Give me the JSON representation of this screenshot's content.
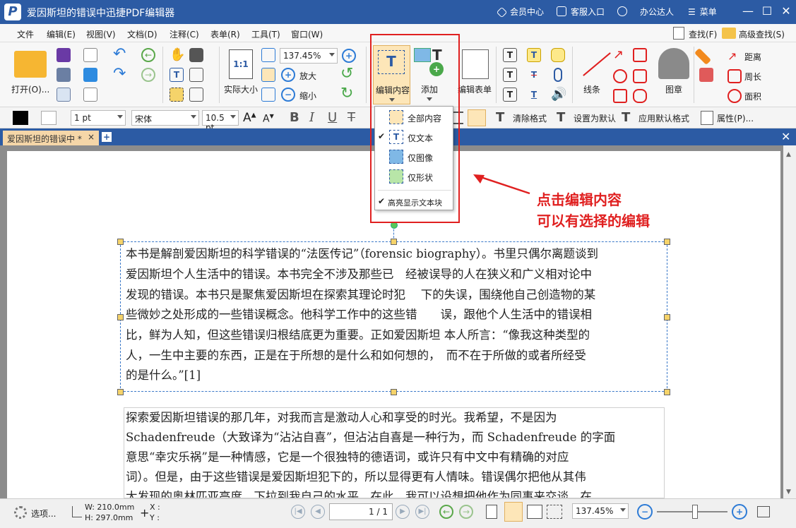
{
  "titlebar": {
    "title": "爱因斯坦的错误中迅捷PDF编辑器",
    "vip": "会员中心",
    "service": "客服入口",
    "user": "办公达人",
    "menu": "菜单",
    "logo": "P"
  },
  "menu": [
    "文件",
    "编辑(E)",
    "视图(V)",
    "文档(D)",
    "注释(C)",
    "表单(R)",
    "工具(T)",
    "窗口(W)"
  ],
  "menu_right": {
    "find": "查找(F)",
    "advanced_find": "高级查找(S)"
  },
  "ribbon": {
    "open": "打开(O)...",
    "actual_size": "实际大小",
    "zoom": "137.45%",
    "zoom_in": "放大",
    "zoom_out": "缩小",
    "edit_content": "编辑内容",
    "add": "添加",
    "edit_form": "编辑表单",
    "line": "线条",
    "stamp": "图章",
    "distance": "距离",
    "perimeter": "周长",
    "area": "面积",
    "actual_size_icon": "1:1"
  },
  "format": {
    "stroke": "1 pt",
    "font": "宋体",
    "size": "10.5 pt",
    "clear_format": "清除格式",
    "set_default": "设置为默认",
    "apply_default": "应用默认格式",
    "properties": "属性(P)..."
  },
  "tab": {
    "label": "爱因斯坦的错误中 *",
    "close": "×"
  },
  "dropdown": {
    "all": "全部内容",
    "text_only": "仅文本",
    "image_only": "仅图像",
    "shape_only": "仅形状",
    "highlight": "高亮显示文本块"
  },
  "annotation": {
    "line1": "点击编辑内容",
    "line2": "可以有选择的编辑"
  },
  "paragraph1": [
    "本书是解剖爱因斯坦的科学错误的“法医传记”（forensic biography）。书里只偶尔离题谈到",
    "爱因斯坦个人生活中的错误。本书完全不涉及那些已　经被误导的人在狭义和广义相对论中",
    "发现的错误。本书只是聚焦爱因斯坦在探索其理论时犯　 下的失误，围绕他自己创造物的某",
    "些微妙之处形成的一些错误概念。他科学工作中的这些错　　误，跟他个人生活中的错误相",
    "比，鲜为人知，但这些错误归根结底更为重要。正如爱因斯坦 本人所言：“像我这种类型的",
    "人，一生中主要的东西，正是在于所想的是什么和如何想的，　而不在于所做的或者所经受",
    "的是什么。”[1]"
  ],
  "paragraph2": [
    "探索爱因斯坦错误的那几年，对我而言是激动人心和享受的时光。我希望，不是因为",
    "Schadenfreude（大致译为“沾沾自喜”，但沾沾自喜是一种行为，而 Schadenfreude 的字面",
    "意思“幸灾乐祸”是一种情感，它是一个很独特的德语词，或许只有中文中有精确的对应",
    "词）。但是，由于这些错误是爱因斯坦犯下的，所以显得更有人情味。错误偶尔把他从其伟",
    "大发现的奥林匹亚高度，下拉到我自己的水平，在此，我可以设想把他作为同事来交谈。在"
  ],
  "status": {
    "options": "选项...",
    "width": "W: 210.0mm",
    "height": "H: 297.0mm",
    "x": "X :",
    "y": "Y :",
    "page": "1 / 1",
    "zoom": "137.45%"
  }
}
